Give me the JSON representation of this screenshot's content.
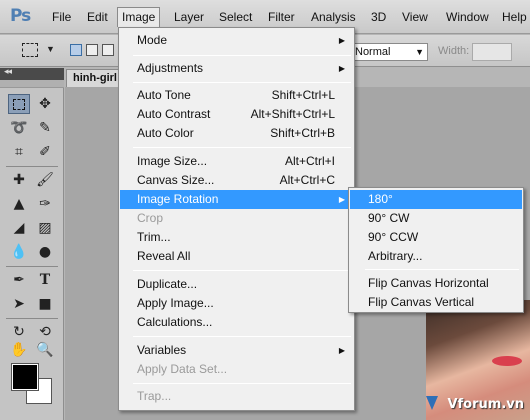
{
  "app": {
    "logo": "Ps"
  },
  "menubar": {
    "items": [
      {
        "label": "File"
      },
      {
        "label": "Edit"
      },
      {
        "label": "Image"
      },
      {
        "label": "Layer"
      },
      {
        "label": "Select"
      },
      {
        "label": "Filter"
      },
      {
        "label": "Analysis"
      },
      {
        "label": "3D"
      },
      {
        "label": "View"
      },
      {
        "label": "Window"
      },
      {
        "label": "Help"
      }
    ],
    "active": "Image"
  },
  "options": {
    "style_value": "Normal",
    "width_label": "Width:"
  },
  "document": {
    "tab_label": "hinh-girl"
  },
  "image_menu": {
    "items": [
      {
        "label": "Mode",
        "shortcut": "",
        "submenu": true
      },
      {
        "label": "Adjustments",
        "shortcut": "",
        "submenu": true
      },
      {
        "label": "Auto Tone",
        "shortcut": "Shift+Ctrl+L"
      },
      {
        "label": "Auto Contrast",
        "shortcut": "Alt+Shift+Ctrl+L"
      },
      {
        "label": "Auto Color",
        "shortcut": "Shift+Ctrl+B"
      },
      {
        "label": "Image Size...",
        "shortcut": "Alt+Ctrl+I"
      },
      {
        "label": "Canvas Size...",
        "shortcut": "Alt+Ctrl+C"
      },
      {
        "label": "Image Rotation",
        "shortcut": "",
        "submenu": true,
        "highlighted": true
      },
      {
        "label": "Crop",
        "shortcut": "",
        "disabled": true
      },
      {
        "label": "Trim...",
        "shortcut": ""
      },
      {
        "label": "Reveal All",
        "shortcut": ""
      },
      {
        "label": "Duplicate...",
        "shortcut": ""
      },
      {
        "label": "Apply Image...",
        "shortcut": ""
      },
      {
        "label": "Calculations...",
        "shortcut": ""
      },
      {
        "label": "Variables",
        "shortcut": "",
        "submenu": true
      },
      {
        "label": "Apply Data Set...",
        "shortcut": "",
        "disabled": true
      },
      {
        "label": "Trap...",
        "shortcut": "",
        "disabled": true
      }
    ]
  },
  "rotation_submenu": {
    "items": [
      {
        "label": "180°",
        "highlighted": true
      },
      {
        "label": "90° CW"
      },
      {
        "label": "90° CCW"
      },
      {
        "label": "Arbitrary..."
      },
      {
        "label": "Flip Canvas Horizontal"
      },
      {
        "label": "Flip Canvas Vertical"
      }
    ]
  },
  "colors": {
    "highlight": "#3399ff",
    "foreground": "#000000",
    "background": "#ffffff"
  },
  "watermark": {
    "text": "Vforum.vn"
  },
  "icons": {
    "menu_arrow": "▶",
    "dropdown_caret": "▼"
  }
}
